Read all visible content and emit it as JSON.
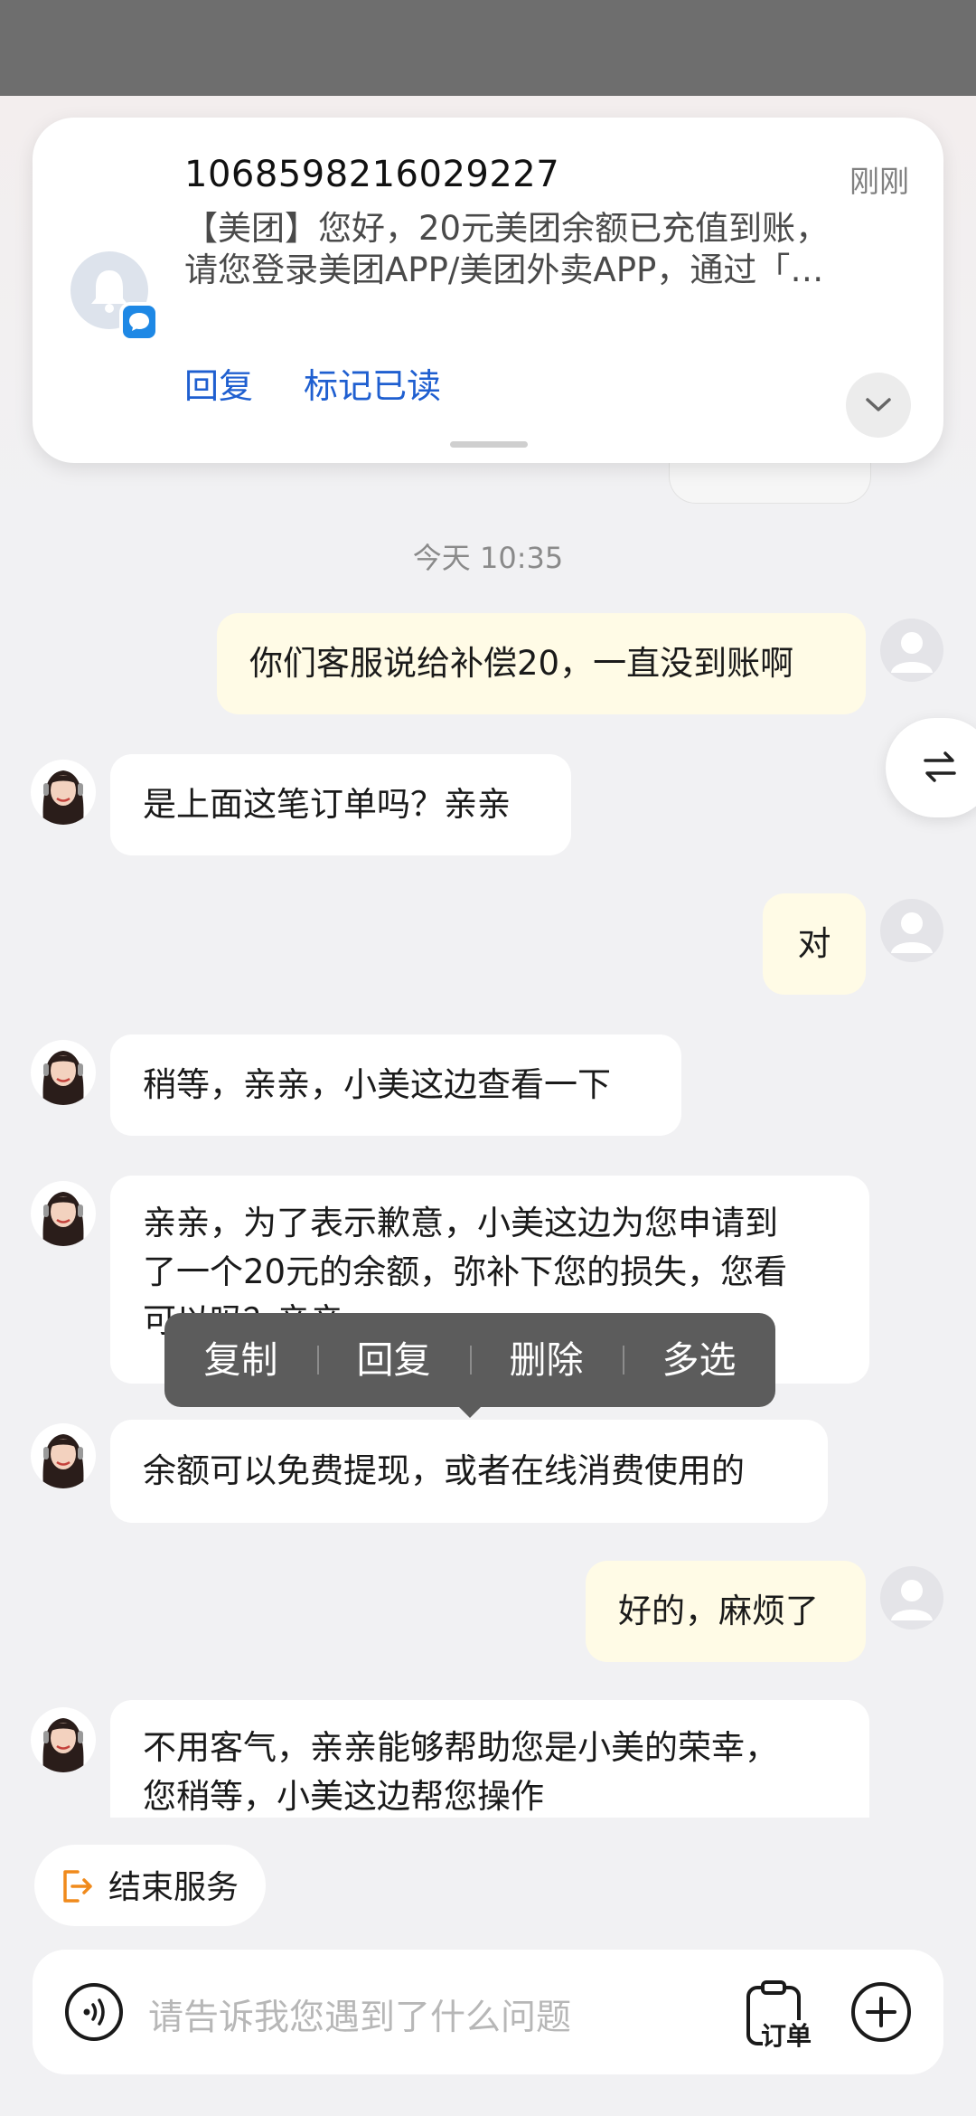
{
  "notification": {
    "sender": "1068598216029227",
    "time": "刚刚",
    "body_line1": "【美团】您好，20元美团余额已充值到账，",
    "body_line2": "请您登录美团APP/美团外卖APP，通过「…",
    "action_reply": "回复",
    "action_mark_read": "标记已读"
  },
  "chat": {
    "time_label": "今天 10:35",
    "messages": [
      {
        "from": "me",
        "text": "你们客服说给补偿20，一直没到账啊"
      },
      {
        "from": "bot",
        "text": "是上面这笔订单吗？亲亲"
      },
      {
        "from": "me",
        "text": "对"
      },
      {
        "from": "bot",
        "text": "稍等，亲亲，小美这边查看一下"
      },
      {
        "from": "bot",
        "lines": [
          "亲亲，为了表示歉意，小美这边为您申请到",
          "了一个20元的余额，弥补下您的损失，您看",
          "可以吗？亲亲"
        ]
      },
      {
        "from": "bot",
        "text": "余额可以免费提现，或者在线消费使用的"
      },
      {
        "from": "me",
        "text": "好的，麻烦了"
      },
      {
        "from": "bot",
        "lines": [
          "不用客气，亲亲能够帮助您是小美的荣幸，",
          "您稍等，小美这边帮您操作"
        ]
      }
    ]
  },
  "context_menu": {
    "items": [
      "复制",
      "回复",
      "删除",
      "多选"
    ]
  },
  "bottom": {
    "end_service": "结束服务",
    "input_placeholder": "请告诉我您遇到了什么问题",
    "order_label": "订单"
  },
  "colors": {
    "my_bubble": "#fffbe6",
    "bot_bubble": "#ffffff",
    "link_blue": "#1f5fd0",
    "end_icon_orange": "#f08a1c"
  }
}
